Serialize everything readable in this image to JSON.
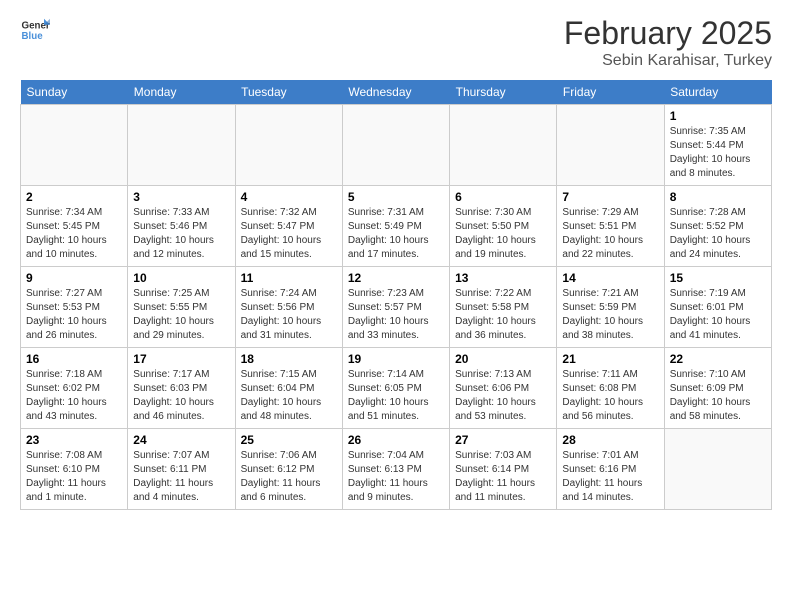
{
  "header": {
    "logo_line1": "General",
    "logo_line2": "Blue",
    "title": "February 2025",
    "subtitle": "Sebin Karahisar, Turkey"
  },
  "days_of_week": [
    "Sunday",
    "Monday",
    "Tuesday",
    "Wednesday",
    "Thursday",
    "Friday",
    "Saturday"
  ],
  "weeks": [
    [
      {
        "day": "",
        "info": ""
      },
      {
        "day": "",
        "info": ""
      },
      {
        "day": "",
        "info": ""
      },
      {
        "day": "",
        "info": ""
      },
      {
        "day": "",
        "info": ""
      },
      {
        "day": "",
        "info": ""
      },
      {
        "day": "1",
        "info": "Sunrise: 7:35 AM\nSunset: 5:44 PM\nDaylight: 10 hours\nand 8 minutes."
      }
    ],
    [
      {
        "day": "2",
        "info": "Sunrise: 7:34 AM\nSunset: 5:45 PM\nDaylight: 10 hours\nand 10 minutes."
      },
      {
        "day": "3",
        "info": "Sunrise: 7:33 AM\nSunset: 5:46 PM\nDaylight: 10 hours\nand 12 minutes."
      },
      {
        "day": "4",
        "info": "Sunrise: 7:32 AM\nSunset: 5:47 PM\nDaylight: 10 hours\nand 15 minutes."
      },
      {
        "day": "5",
        "info": "Sunrise: 7:31 AM\nSunset: 5:49 PM\nDaylight: 10 hours\nand 17 minutes."
      },
      {
        "day": "6",
        "info": "Sunrise: 7:30 AM\nSunset: 5:50 PM\nDaylight: 10 hours\nand 19 minutes."
      },
      {
        "day": "7",
        "info": "Sunrise: 7:29 AM\nSunset: 5:51 PM\nDaylight: 10 hours\nand 22 minutes."
      },
      {
        "day": "8",
        "info": "Sunrise: 7:28 AM\nSunset: 5:52 PM\nDaylight: 10 hours\nand 24 minutes."
      }
    ],
    [
      {
        "day": "9",
        "info": "Sunrise: 7:27 AM\nSunset: 5:53 PM\nDaylight: 10 hours\nand 26 minutes."
      },
      {
        "day": "10",
        "info": "Sunrise: 7:25 AM\nSunset: 5:55 PM\nDaylight: 10 hours\nand 29 minutes."
      },
      {
        "day": "11",
        "info": "Sunrise: 7:24 AM\nSunset: 5:56 PM\nDaylight: 10 hours\nand 31 minutes."
      },
      {
        "day": "12",
        "info": "Sunrise: 7:23 AM\nSunset: 5:57 PM\nDaylight: 10 hours\nand 33 minutes."
      },
      {
        "day": "13",
        "info": "Sunrise: 7:22 AM\nSunset: 5:58 PM\nDaylight: 10 hours\nand 36 minutes."
      },
      {
        "day": "14",
        "info": "Sunrise: 7:21 AM\nSunset: 5:59 PM\nDaylight: 10 hours\nand 38 minutes."
      },
      {
        "day": "15",
        "info": "Sunrise: 7:19 AM\nSunset: 6:01 PM\nDaylight: 10 hours\nand 41 minutes."
      }
    ],
    [
      {
        "day": "16",
        "info": "Sunrise: 7:18 AM\nSunset: 6:02 PM\nDaylight: 10 hours\nand 43 minutes."
      },
      {
        "day": "17",
        "info": "Sunrise: 7:17 AM\nSunset: 6:03 PM\nDaylight: 10 hours\nand 46 minutes."
      },
      {
        "day": "18",
        "info": "Sunrise: 7:15 AM\nSunset: 6:04 PM\nDaylight: 10 hours\nand 48 minutes."
      },
      {
        "day": "19",
        "info": "Sunrise: 7:14 AM\nSunset: 6:05 PM\nDaylight: 10 hours\nand 51 minutes."
      },
      {
        "day": "20",
        "info": "Sunrise: 7:13 AM\nSunset: 6:06 PM\nDaylight: 10 hours\nand 53 minutes."
      },
      {
        "day": "21",
        "info": "Sunrise: 7:11 AM\nSunset: 6:08 PM\nDaylight: 10 hours\nand 56 minutes."
      },
      {
        "day": "22",
        "info": "Sunrise: 7:10 AM\nSunset: 6:09 PM\nDaylight: 10 hours\nand 58 minutes."
      }
    ],
    [
      {
        "day": "23",
        "info": "Sunrise: 7:08 AM\nSunset: 6:10 PM\nDaylight: 11 hours\nand 1 minute."
      },
      {
        "day": "24",
        "info": "Sunrise: 7:07 AM\nSunset: 6:11 PM\nDaylight: 11 hours\nand 4 minutes."
      },
      {
        "day": "25",
        "info": "Sunrise: 7:06 AM\nSunset: 6:12 PM\nDaylight: 11 hours\nand 6 minutes."
      },
      {
        "day": "26",
        "info": "Sunrise: 7:04 AM\nSunset: 6:13 PM\nDaylight: 11 hours\nand 9 minutes."
      },
      {
        "day": "27",
        "info": "Sunrise: 7:03 AM\nSunset: 6:14 PM\nDaylight: 11 hours\nand 11 minutes."
      },
      {
        "day": "28",
        "info": "Sunrise: 7:01 AM\nSunset: 6:16 PM\nDaylight: 11 hours\nand 14 minutes."
      },
      {
        "day": "",
        "info": ""
      }
    ]
  ]
}
